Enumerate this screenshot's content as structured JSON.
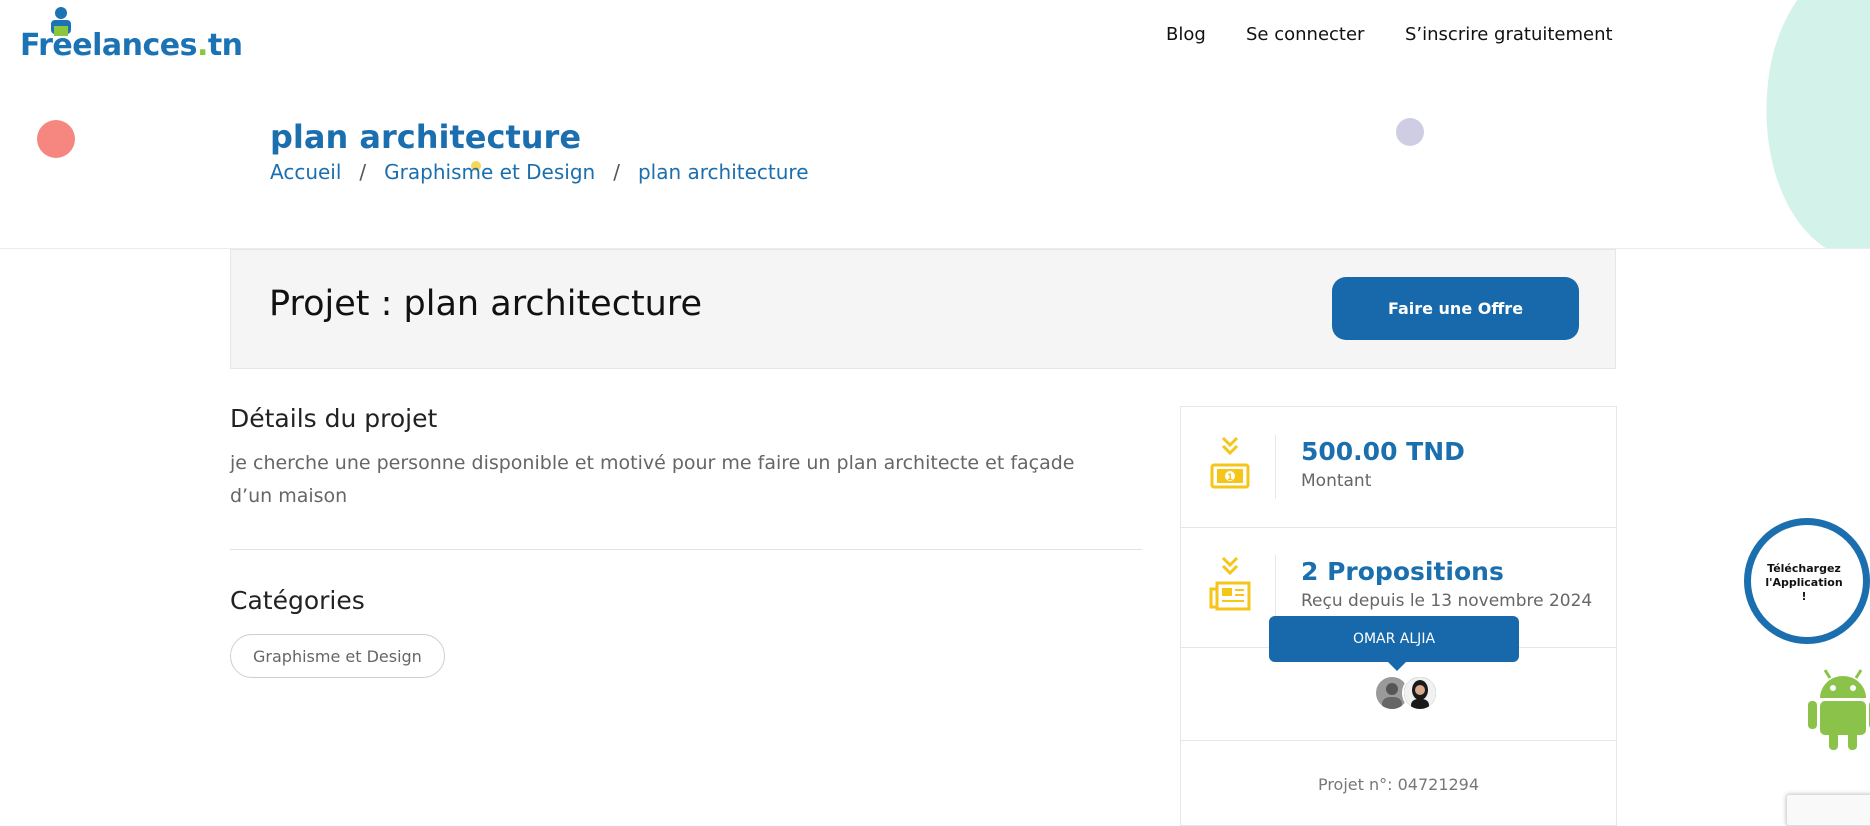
{
  "brand": {
    "logo_main": "Freelances",
    "logo_dot": ".",
    "logo_tld": "tn",
    "color_primary": "#1769ab",
    "color_accent": "#f5c518"
  },
  "nav": {
    "blog": "Blog",
    "login": "Se connecter",
    "signup": "S’inscrire gratuitement"
  },
  "hero": {
    "title": "plan architecture",
    "breadcrumb": [
      "Accueil",
      "Graphisme et Design",
      "plan architecture"
    ],
    "separator": "/"
  },
  "project": {
    "title": "Projet : plan architecture",
    "offer_button": "Faire une Offre"
  },
  "details": {
    "heading": "Détails du projet",
    "text": "je cherche une personne disponible et motivé pour me faire un plan architecte et façade d’un maison"
  },
  "categories": {
    "heading": "Catégories",
    "items": [
      "Graphisme et Design"
    ]
  },
  "summary": {
    "amount_value": "500.00 TND",
    "amount_label": "Montant",
    "proposals_value": "2 Propositions",
    "proposals_label": "Reçu depuis le 13 novembre 2024",
    "tooltip_name": "OMAR ALJIA",
    "project_number": "Projet n°: 04721294",
    "icons": [
      "money-icon",
      "newspaper-icon"
    ]
  },
  "app_badge": {
    "line1": "Téléchargez",
    "line2": "l'Application !"
  }
}
